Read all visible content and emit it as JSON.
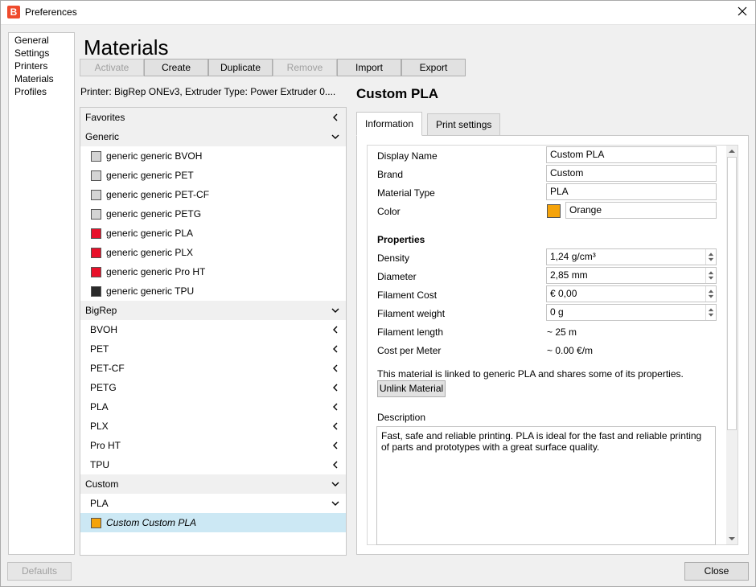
{
  "window": {
    "title": "Preferences",
    "app_icon_letter": "B"
  },
  "nav": {
    "items": [
      "General",
      "Settings",
      "Printers",
      "Materials",
      "Profiles"
    ]
  },
  "page": {
    "title": "Materials"
  },
  "toolbar": {
    "activate": "Activate",
    "create": "Create",
    "duplicate": "Duplicate",
    "remove": "Remove",
    "import": "Import",
    "export": "Export"
  },
  "printer_info": "Printer: BigRep ONEv3, Extruder Type: Power Extruder 0....",
  "list": {
    "favorites": "Favorites",
    "generic": "Generic",
    "generic_items": [
      {
        "label": "generic generic BVOH",
        "color": "#d4d4d4"
      },
      {
        "label": "generic generic PET",
        "color": "#d4d4d4"
      },
      {
        "label": "generic generic PET-CF",
        "color": "#d4d4d4"
      },
      {
        "label": "generic generic PETG",
        "color": "#d4d4d4"
      },
      {
        "label": "generic generic PLA",
        "color": "#e8102a"
      },
      {
        "label": "generic generic PLX",
        "color": "#e8102a"
      },
      {
        "label": "generic generic Pro HT",
        "color": "#e8102a"
      },
      {
        "label": "generic generic TPU",
        "color": "#2a2a2a"
      }
    ],
    "bigrep": "BigRep",
    "bigrep_items": [
      "BVOH",
      "PET",
      "PET-CF",
      "PETG",
      "PLA",
      "PLX",
      "Pro HT",
      "TPU"
    ],
    "custom": "Custom",
    "custom_sub": "PLA",
    "custom_item": {
      "label": "Custom Custom PLA",
      "color": "#f5a30a"
    }
  },
  "material": {
    "title": "Custom PLA",
    "tabs": [
      "Information",
      "Print settings"
    ],
    "labels": {
      "display_name": "Display Name",
      "brand": "Brand",
      "material_type": "Material Type",
      "color": "Color",
      "properties": "Properties",
      "density": "Density",
      "diameter": "Diameter",
      "filament_cost": "Filament Cost",
      "filament_weight": "Filament weight",
      "filament_length": "Filament length",
      "cost_per_meter": "Cost per Meter",
      "description": "Description"
    },
    "values": {
      "display_name": "Custom PLA",
      "brand": "Custom",
      "material_type": "PLA",
      "color_name": "Orange",
      "color_hex": "#f5a30a",
      "density": "1,24 g/cm³",
      "diameter": "2,85 mm",
      "filament_cost": "€ 0,00",
      "filament_weight": "0 g",
      "filament_length": "~ 25 m",
      "cost_per_meter": "~ 0.00 €/m"
    },
    "link_note": "This material is linked to generic PLA and shares some of its properties.",
    "unlink": "Unlink Material",
    "description": "Fast, safe and reliable printing. PLA is ideal for the fast and reliable printing of parts and prototypes with a great surface quality."
  },
  "footer": {
    "defaults": "Defaults",
    "close": "Close"
  }
}
